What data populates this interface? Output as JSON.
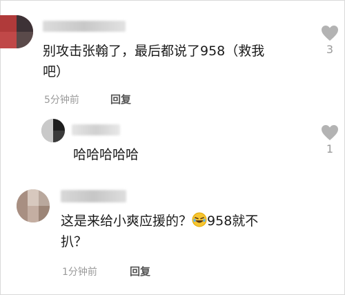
{
  "comments": [
    {
      "text_line1": "别攻击张翰了，最后都说了958（救我",
      "text_line2": "吧）",
      "time": "5分钟前",
      "reply_label": "回复",
      "like_count": "3"
    },
    {
      "text": "哈哈哈哈哈",
      "like_count": "1"
    },
    {
      "text_part1": "这是来给小爽应援的？",
      "text_part2": "958就不",
      "text_line2": "扒？",
      "emoji": "rolling-on-floor-laughing-emoji",
      "time": "1分钟前",
      "reply_label": "回复"
    }
  ],
  "colors": {
    "text": "#1a1a1a",
    "meta": "#9a9a9a",
    "like_icon": "#b3b3b3"
  }
}
